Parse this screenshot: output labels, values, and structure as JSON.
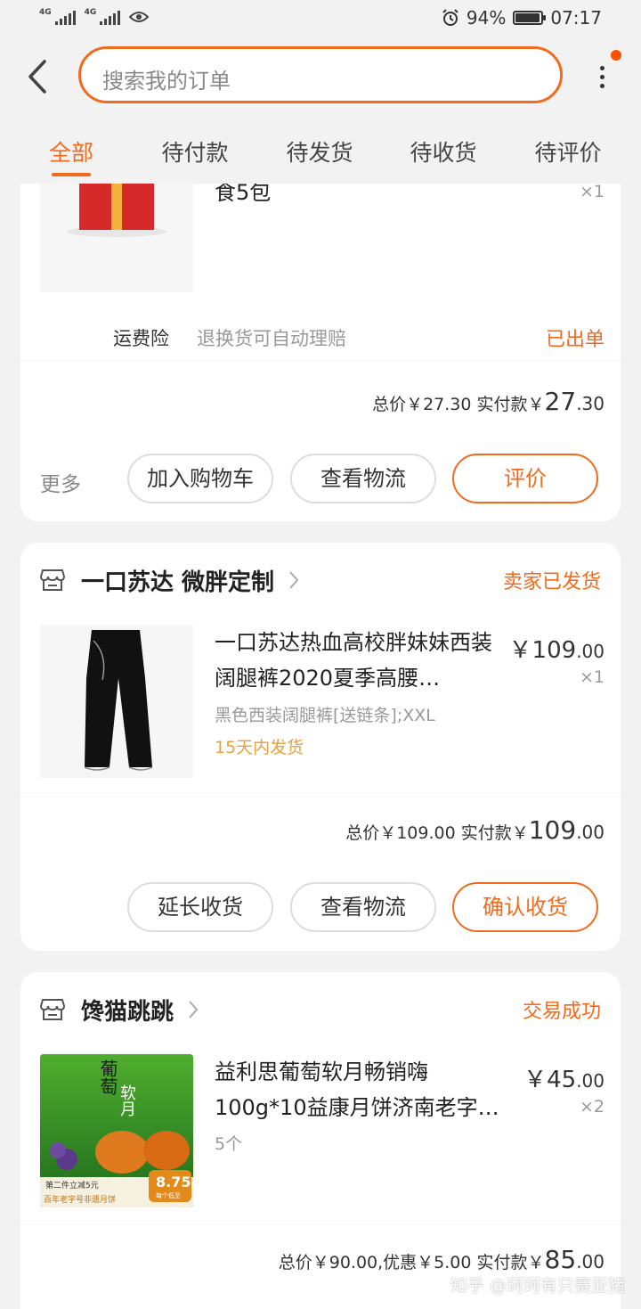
{
  "statusbar": {
    "network1": "4G",
    "network2": "4G",
    "battery": "94%",
    "battery_level": 0.94,
    "time": "07:17"
  },
  "header": {
    "search_placeholder": "搜索我的订单",
    "tabs": [
      "全部",
      "待付款",
      "待发货",
      "待收货",
      "待评价"
    ],
    "active_tab": 0
  },
  "orders": [
    {
      "item": {
        "title_tail": "食5包",
        "qty": "×1"
      },
      "insurance": {
        "label": "运费险",
        "desc": "退换货可自动理赔",
        "status": "已出单"
      },
      "total": {
        "label": "总价￥27.30 实付款",
        "currency": "￥",
        "amount_int": "27",
        "amount_dec": ".30"
      },
      "more": "更多",
      "buttons": [
        "加入购物车",
        "查看物流",
        "评价"
      ]
    },
    {
      "shop": "一口苏达 微胖定制",
      "status": "卖家已发货",
      "item": {
        "title": "一口苏达热血高校胖妹妹西装阔腿裤2020夏季高腰…",
        "sku": "黑色西装阔腿裤[送链条];XXL",
        "note": "15天内发货",
        "price_currency": "￥",
        "price_int": "109",
        "price_dec": ".00",
        "qty": "×1"
      },
      "total": {
        "label": "总价￥109.00 实付款",
        "currency": "￥",
        "amount_int": "109",
        "amount_dec": ".00"
      },
      "buttons": [
        "延长收货",
        "查看物流",
        "确认收货"
      ]
    },
    {
      "shop": "馋猫跳跳",
      "status": "交易成功",
      "item": {
        "title": "益利思葡萄软月畅销嗨100g*10益康月饼济南老字…",
        "sku": "5个",
        "price_currency": "￥",
        "price_int": "45",
        "price_dec": ".00",
        "qty": "×2",
        "image_text": {
          "brand": "葡萄",
          "sub": "软月",
          "promo": "第二件立减5元",
          "slogan": "百年老字号非遗月饼",
          "price": "8.75",
          "unit": "每个低至"
        }
      },
      "total": {
        "label": "总价￥90.00,优惠￥5.00 实付款",
        "currency": "￥",
        "amount_int": "85",
        "amount_dec": ".00"
      }
    }
  ],
  "watermark": "知乎 @珂珂有只赛亚猪",
  "colors": {
    "accent": "#f26b1d",
    "note": "#e6a23c",
    "bg": "#f2f2f2"
  }
}
